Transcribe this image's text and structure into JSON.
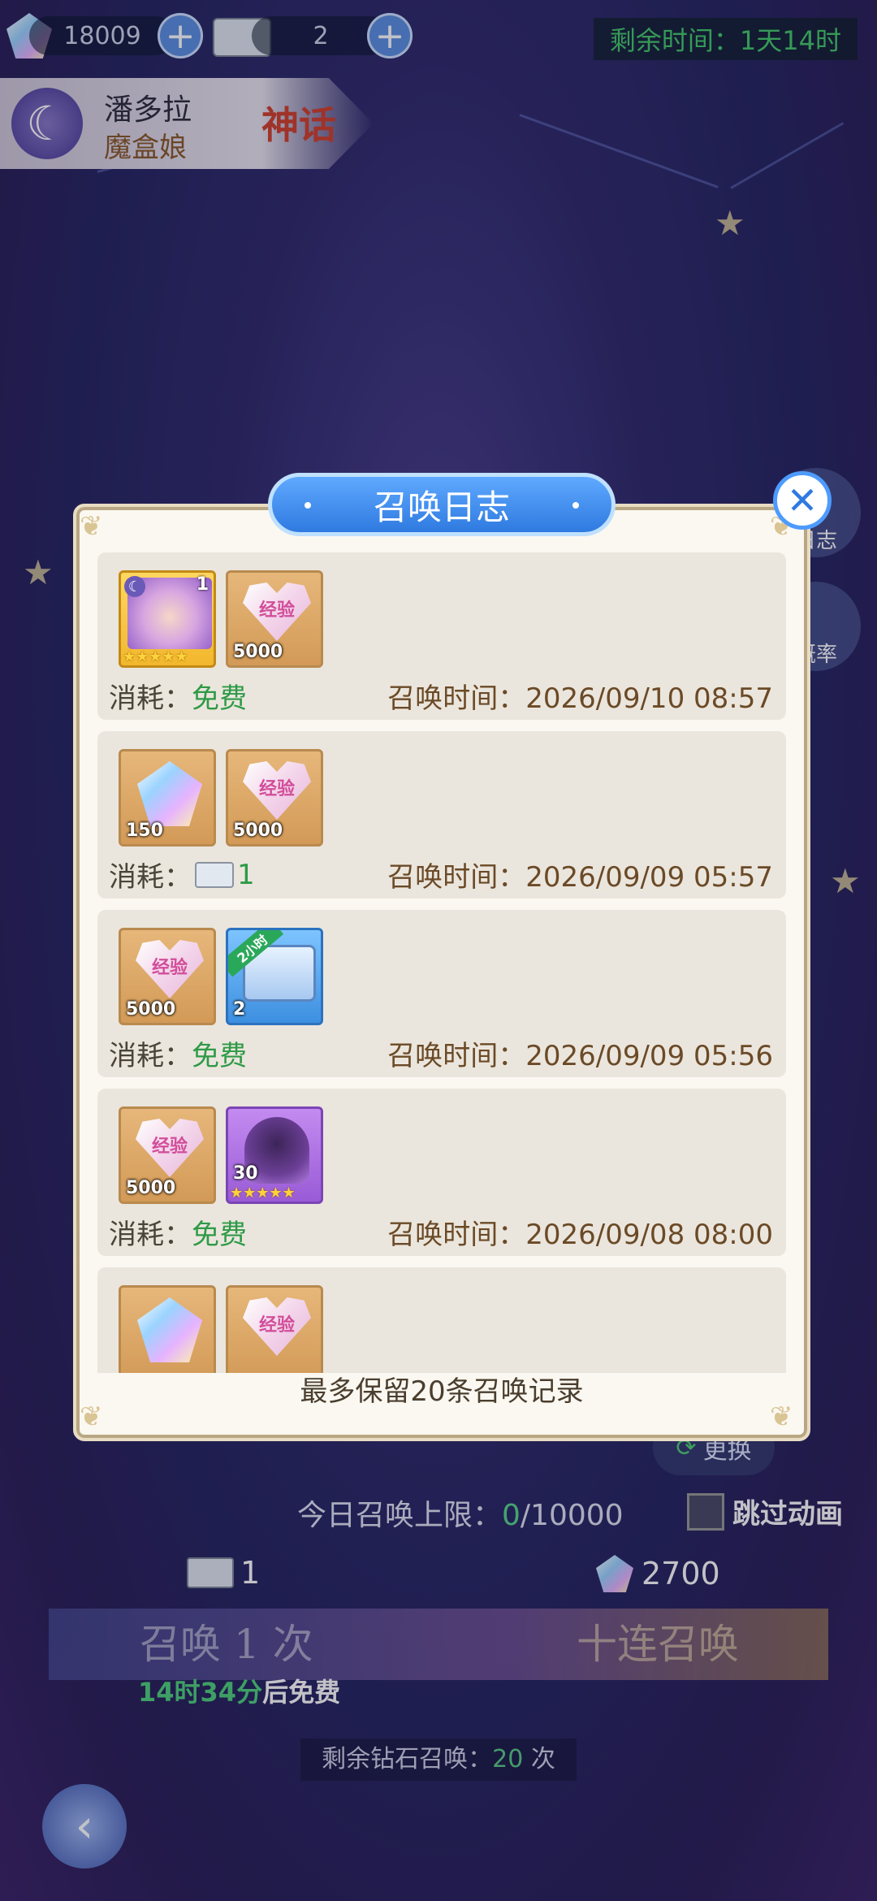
{
  "top": {
    "gems": "18009",
    "tickets": "2",
    "remaining_label": "剩余时间：1天14时"
  },
  "hero": {
    "name": "潘多拉",
    "title": "魔盒娘",
    "rank": "神话"
  },
  "side": {
    "log": "日志",
    "rate": "概率"
  },
  "modal": {
    "title": "召唤日志",
    "footer": "最多保留20条召唤记录",
    "entries": [
      {
        "items": [
          {
            "type": "portrait",
            "top": "1",
            "stars": "★★★★★"
          },
          {
            "type": "exp",
            "label": "经验",
            "count": "5000"
          }
        ],
        "consume_label": "消耗：",
        "consume_value": "免费",
        "time": "召唤时间：2026/09/10 08:57"
      },
      {
        "items": [
          {
            "type": "crystal",
            "count": "150"
          },
          {
            "type": "exp",
            "label": "经验",
            "count": "5000"
          }
        ],
        "consume_label": "消耗：",
        "consume_value": "1",
        "time": "召唤时间：2026/09/09 05:57"
      },
      {
        "items": [
          {
            "type": "exp",
            "label": "经验",
            "count": "5000"
          },
          {
            "type": "chest",
            "ribbon": "2小时",
            "count": "2"
          }
        ],
        "consume_label": "消耗：",
        "consume_value": "免费",
        "time": "召唤时间：2026/09/09 05:56"
      },
      {
        "items": [
          {
            "type": "exp",
            "label": "经验",
            "count": "5000"
          },
          {
            "type": "hood",
            "count": "30",
            "stars": "★★★★★"
          }
        ],
        "consume_label": "消耗：",
        "consume_value": "免费",
        "time": "召唤时间：2026/09/08 08:00"
      },
      {
        "items": [
          {
            "type": "crystal"
          },
          {
            "type": "exp",
            "label": "经验"
          }
        ]
      }
    ]
  },
  "bottom": {
    "change": "更换",
    "daily_limit_prefix": "今日召唤上限：",
    "daily_limit_used": "0",
    "daily_limit_total": "/10000",
    "skip_label": "跳过动画",
    "single_cost": "1",
    "ten_cost": "2700",
    "summon_one": "召唤 1 次",
    "summon_ten": "十连召唤",
    "free_time": "14时34分",
    "free_suffix": "后免费",
    "diamond_prefix": "剩余钻石召唤：",
    "diamond_count": "20",
    "diamond_suffix": " 次"
  }
}
